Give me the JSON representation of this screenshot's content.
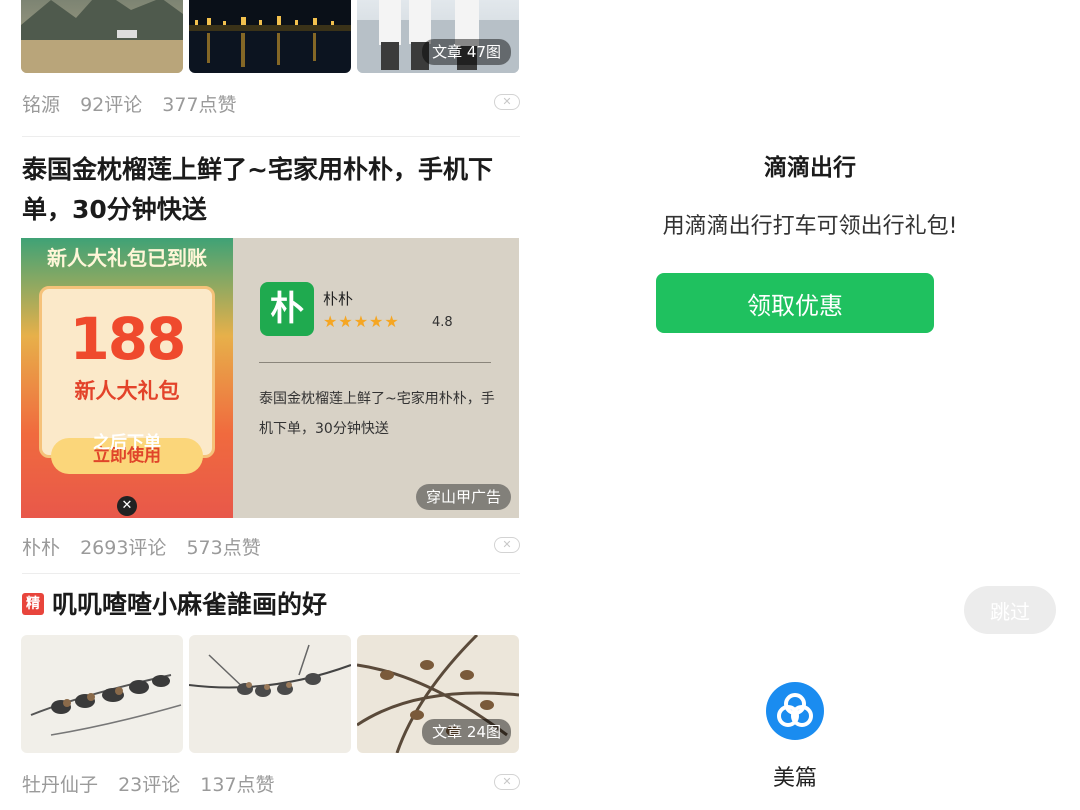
{
  "feed": {
    "post1": {
      "badge": "文章  47图",
      "author": "铭源",
      "comments": "92评论",
      "likes": "377点赞"
    },
    "post2": {
      "title": "泰国金枕榴莲上鲜了~宅家用朴朴，手机下单，30分钟快送",
      "ad": {
        "poster_banner": "新人大礼包已到账",
        "poster_amount": "188",
        "poster_gift": "新人大礼包",
        "poster_after": "之后下单",
        "poster_use": "立即使用",
        "app_logo_text": "朴",
        "app_name": "朴朴",
        "stars": "★★★★★",
        "rating": "4.8",
        "description": "泰国金枕榴莲上鲜了~宅家用朴朴，手机下单，30分钟快送",
        "tag": "穿山甲广告"
      },
      "author": "朴朴",
      "comments": "2693评论",
      "likes": "573点赞"
    },
    "post3": {
      "featured_label": "精",
      "title": "叽叽喳喳小麻雀誰画的好",
      "badge": "文章  24图",
      "author": "牡丹仙子",
      "comments": "23评论",
      "likes": "137点赞"
    },
    "dismiss_symbol": "✕"
  },
  "splash": {
    "title": "滴滴出行",
    "subtitle": "用滴滴出行打车可领出行礼包!",
    "cta": "领取优惠",
    "skip": "跳过",
    "brand_name": "美篇"
  },
  "colors": {
    "accent_green": "#1fc15f",
    "brand_blue": "#1a8cf0",
    "star_gold": "#f5a623",
    "featured_red": "#e8453c"
  }
}
